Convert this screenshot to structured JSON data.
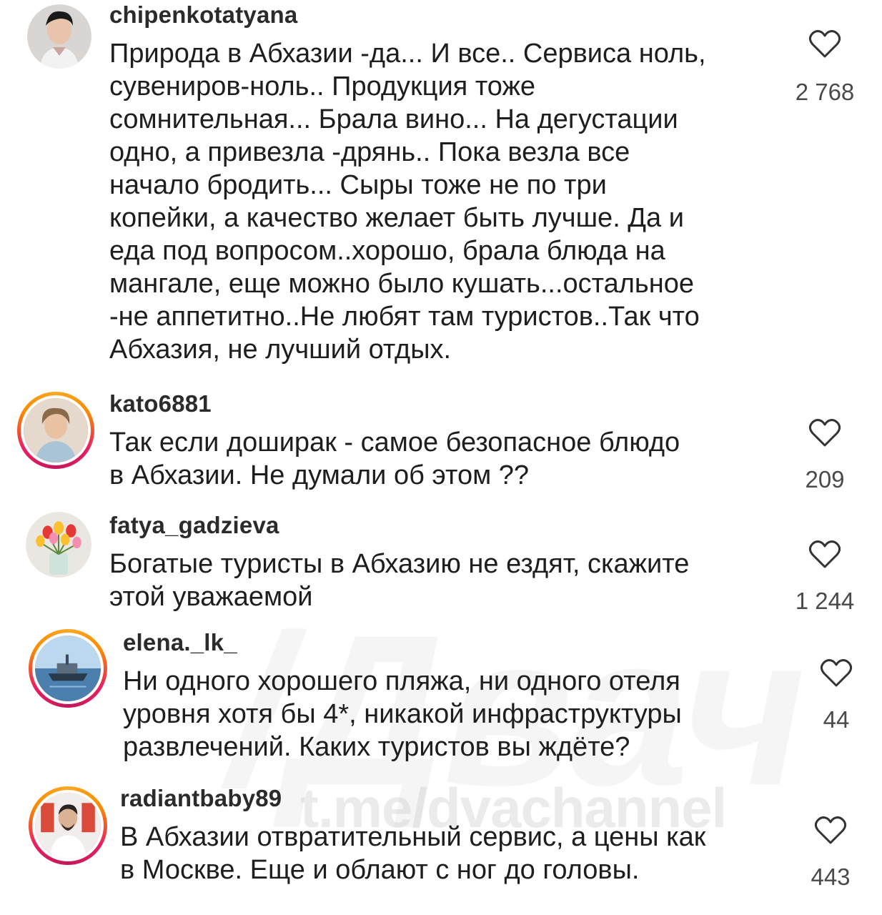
{
  "comments": [
    {
      "username": "chipenkotatyana",
      "text": "Природа в Абхазии -да... И все.. Сервиса ноль,\nсувениров-ноль.. Продукция тоже\nсомнительная... Брала вино... На дегустации\nодно, а привезла -дрянь.. Пока везла все\nначало бродить... Сыры тоже не по три\nкопейки, а качество желает быть лучше. Да и\nеда под вопросом..хорошо, брала блюда на\nмангале, еще можно было кушать...остальное\n-не аппетитно..Не любят там туристов..Так что\nАбхазия, не лучший отдых.",
      "likes": "2 768"
    },
    {
      "username": "kato6881",
      "text": "Так если доширак - самое безопасное блюдо\nв Абхазии. Не думали об этом ??",
      "likes": "209"
    },
    {
      "username": "fatya_gadzieva",
      "text": "Богатые туристы в Абхазию не ездят, скажите\nэтой уважаемой",
      "likes": "1 244"
    },
    {
      "username": "elena._lk_",
      "text": "Ни одного хорошего пляжа, ни одного отеля\nуровня хотя бы 4*, никакой инфраструктуры\nразвлечений. Каких туристов вы ждёте?",
      "likes": "44"
    },
    {
      "username": "radiantbaby89",
      "text": "В Абхазии отвратительный сервис, а цены как\nв Москве. Еще и облают с ног до головы.",
      "likes": "443"
    }
  ],
  "watermark": {
    "text": "t.me/dvachannel"
  },
  "icons": {
    "like": "heart-icon"
  },
  "colors": {
    "story_ring": "#e91e63",
    "text": "#1e1e1e",
    "count": "#4a4a4a"
  }
}
